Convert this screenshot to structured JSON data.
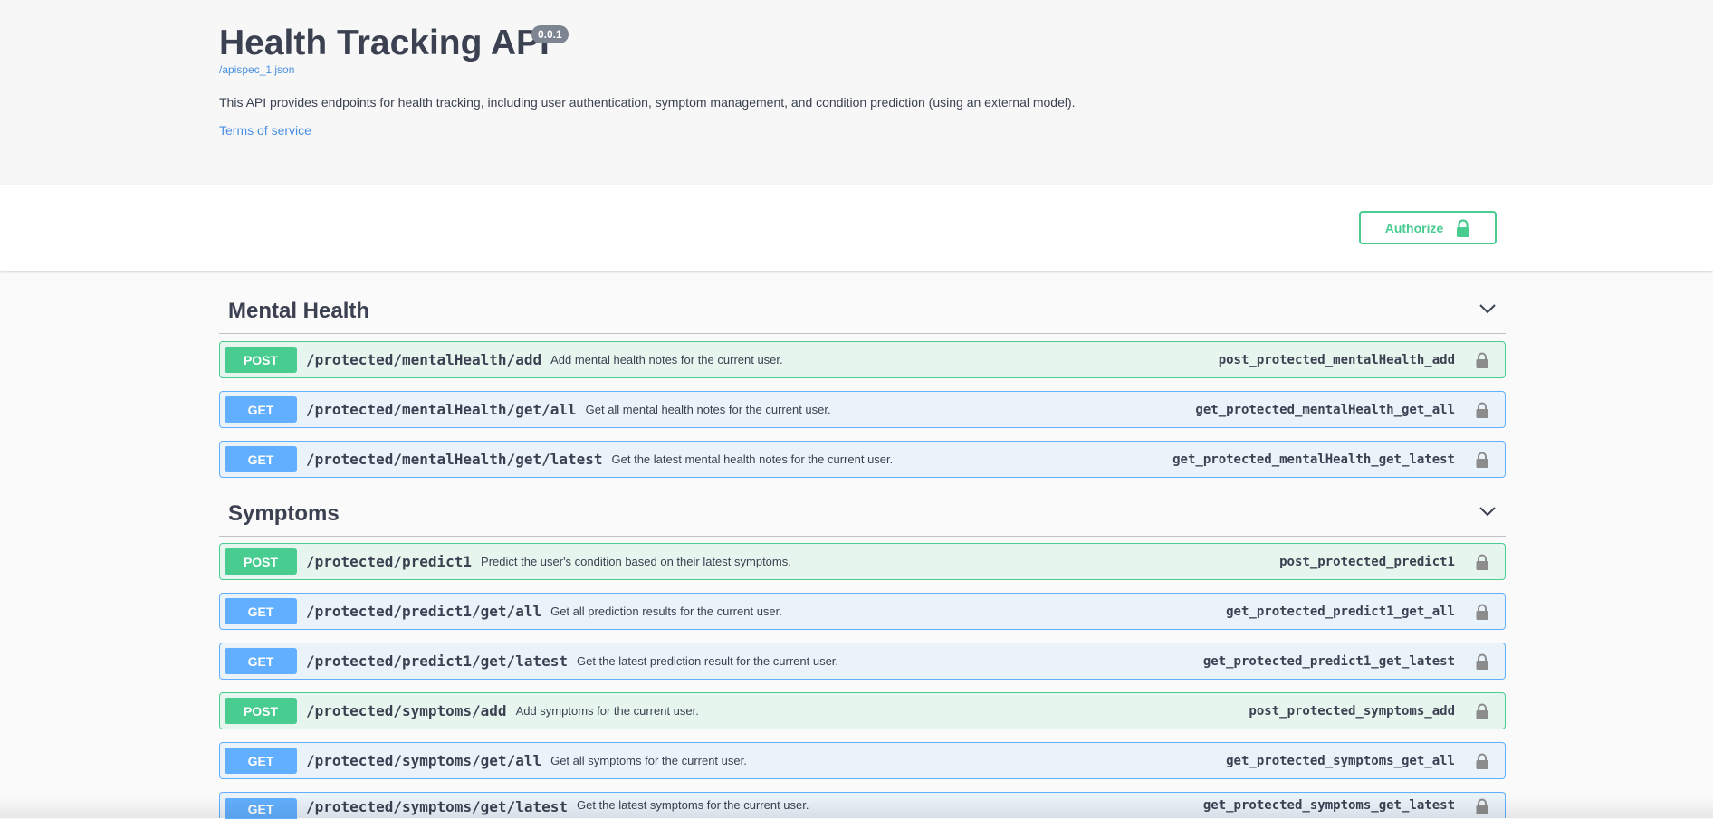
{
  "info": {
    "title": "Health Tracking API",
    "version": "0.0.1",
    "spec_link": "/apispec_1.json",
    "description": "This API provides endpoints for health tracking, including user authentication, symptom management, and condition prediction (using an external model).",
    "terms_link": "Terms of service"
  },
  "authorize": {
    "label": "Authorize",
    "icon": "lock-icon"
  },
  "colors": {
    "post": "#49cc90",
    "get": "#61affe",
    "link": "#4990e2",
    "text": "#3b4151"
  },
  "tags": [
    {
      "name": "Mental Health",
      "operations": [
        {
          "method": "POST",
          "path": "/protected/mentalHealth/add",
          "summary": "Add mental health notes for the current user.",
          "operation_id": "post_protected_mentalHealth_add"
        },
        {
          "method": "GET",
          "path": "/protected/mentalHealth/get/all",
          "summary": "Get all mental health notes for the current user.",
          "operation_id": "get_protected_mentalHealth_get_all"
        },
        {
          "method": "GET",
          "path": "/protected/mentalHealth/get/latest",
          "summary": "Get the latest mental health notes for the current user.",
          "operation_id": "get_protected_mentalHealth_get_latest"
        }
      ]
    },
    {
      "name": "Symptoms",
      "operations": [
        {
          "method": "POST",
          "path": "/protected/predict1",
          "summary": "Predict the user's condition based on their latest symptoms.",
          "operation_id": "post_protected_predict1"
        },
        {
          "method": "GET",
          "path": "/protected/predict1/get/all",
          "summary": "Get all prediction results for the current user.",
          "operation_id": "get_protected_predict1_get_all"
        },
        {
          "method": "GET",
          "path": "/protected/predict1/get/latest",
          "summary": "Get the latest prediction result for the current user.",
          "operation_id": "get_protected_predict1_get_latest"
        },
        {
          "method": "POST",
          "path": "/protected/symptoms/add",
          "summary": "Add symptoms for the current user.",
          "operation_id": "post_protected_symptoms_add"
        },
        {
          "method": "GET",
          "path": "/protected/symptoms/get/all",
          "summary": "Get all symptoms for the current user.",
          "operation_id": "get_protected_symptoms_get_all"
        },
        {
          "method": "GET",
          "path": "/protected/symptoms/get/latest",
          "summary": "Get the latest symptoms for the current user.",
          "operation_id": "get_protected_symptoms_get_latest"
        }
      ]
    }
  ]
}
